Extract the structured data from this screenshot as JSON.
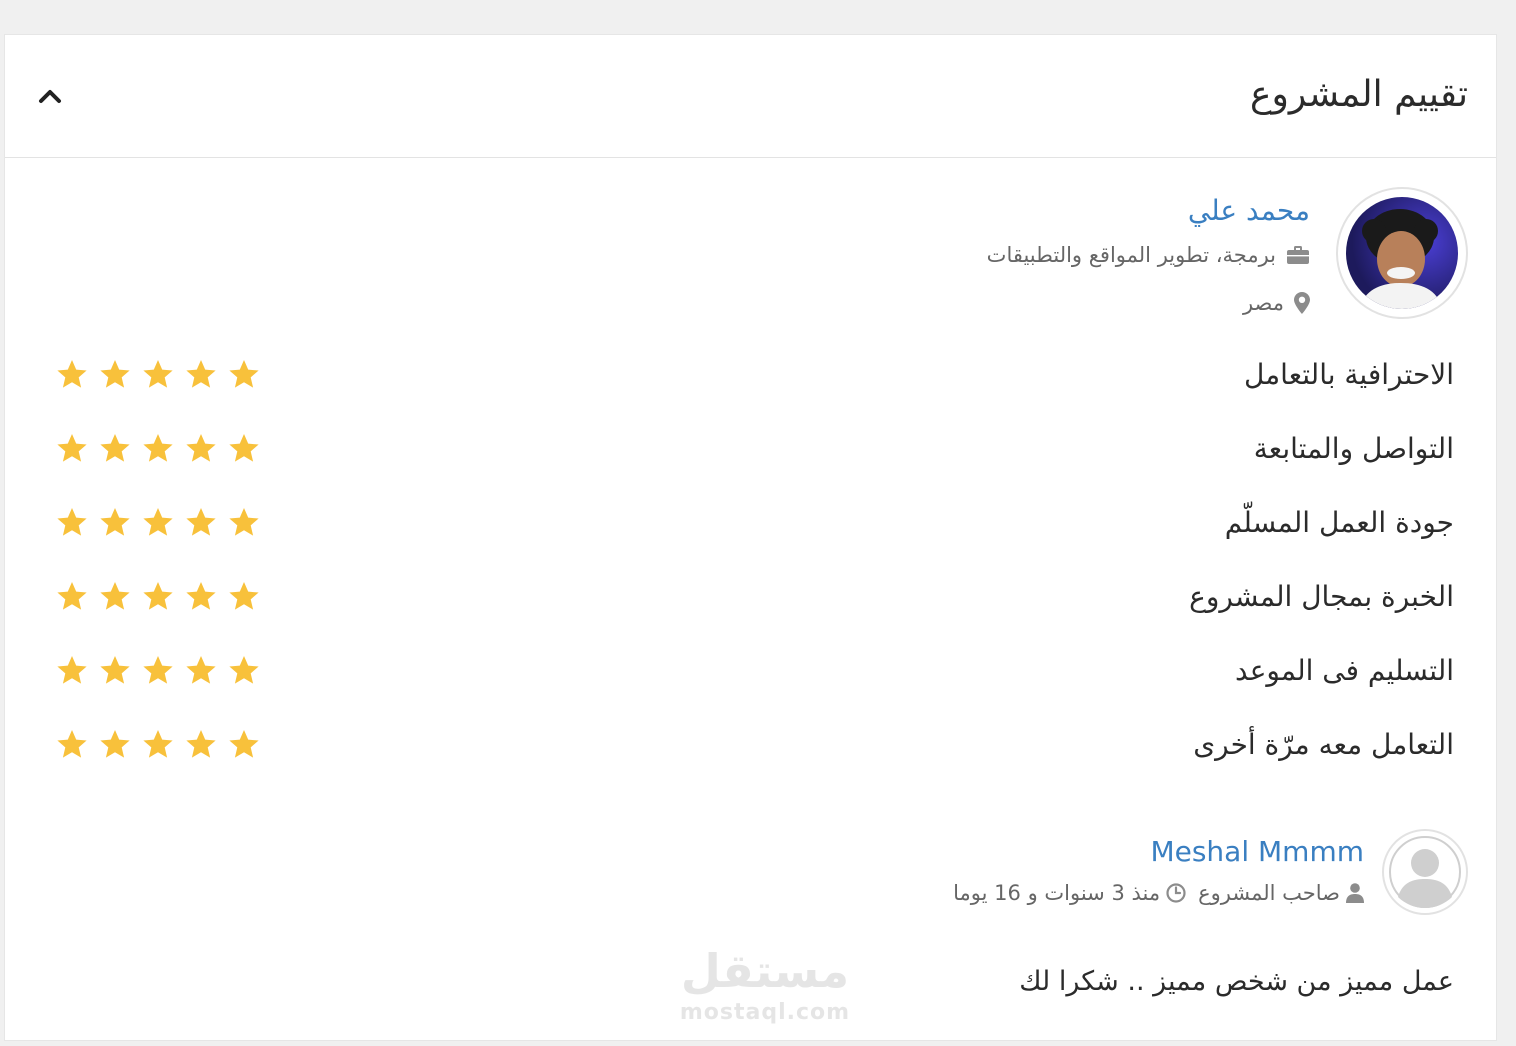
{
  "section": {
    "title": "تقييم المشروع",
    "collapse_icon": "chevron-up-icon"
  },
  "freelancer": {
    "name": "محمد علي",
    "skills": "برمجة، تطوير المواقع والتطبيقات",
    "country": "مصر",
    "skills_icon": "briefcase-icon",
    "country_icon": "map-marker-icon"
  },
  "ratings": {
    "star_color": "#f8c13b",
    "max": 5,
    "items": [
      {
        "label": "الاحترافية بالتعامل",
        "value": 5
      },
      {
        "label": "التواصل والمتابعة",
        "value": 5
      },
      {
        "label": "جودة العمل المسلّم",
        "value": 5
      },
      {
        "label": "الخبرة بمجال المشروع",
        "value": 5
      },
      {
        "label": "التسليم فى الموعد",
        "value": 5
      },
      {
        "label": "التعامل معه مرّة أخرى",
        "value": 5
      }
    ]
  },
  "review": {
    "reviewer_name": "Meshal Mmmm",
    "role": "صاحب المشروع",
    "time": "منذ 3 سنوات و 16 يوما",
    "text": "عمل مميز من شخص مميز .. شكرا لك",
    "role_icon": "user-icon",
    "time_icon": "clock-icon"
  },
  "watermark": {
    "arabic": "مستقل",
    "latin": "mostaql.com"
  },
  "colors": {
    "link": "#3a7fc1",
    "background": "#f0f0f0",
    "card": "#ffffff"
  }
}
